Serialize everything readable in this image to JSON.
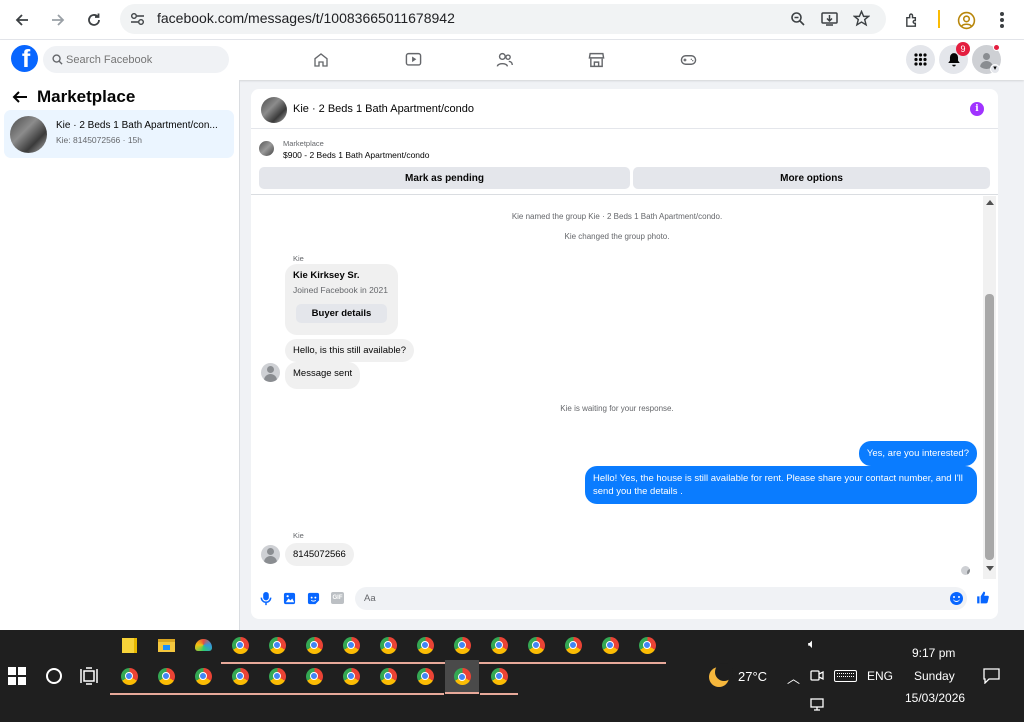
{
  "browser": {
    "url": "facebook.com/messages/t/10083665011678942"
  },
  "fb": {
    "search_placeholder": "Search Facebook",
    "notif_count": "9"
  },
  "sidebar": {
    "title": "Marketplace",
    "conversation": {
      "title": "Kie · 2 Beds 1 Bath Apartment/con...",
      "subtitle": "Kie: 8145072566 · 15h"
    }
  },
  "chat": {
    "title": "Kie · 2 Beds 1 Bath Apartment/condo",
    "listing_label": "Marketplace",
    "listing_detail": "$900 - 2 Beds 1 Bath Apartment/condo",
    "mark_pending": "Mark as pending",
    "more_options": "More options",
    "sys1": "Kie named the group Kie · 2 Beds 1 Bath Apartment/condo.",
    "sys2": "Kie changed the group photo.",
    "sender1": "Kie",
    "buyer_name": "Kie Kirksey Sr.",
    "buyer_joined": "Joined Facebook in 2021",
    "buyer_details_btn": "Buyer details",
    "msg1": "Hello, is this still available?",
    "msg2": "Message sent",
    "sys3": "Kie is waiting for your response.",
    "out1": "Yes, are you interested?",
    "out2": "Hello! Yes, the house is still available for rent. Please share your contact number, and I'll send you the details .",
    "sender2": "Kie",
    "msg3": "8145072566",
    "composer_placeholder": "Aa"
  },
  "taskbar": {
    "weather": "27°C",
    "lang": "ENG",
    "time": "9:17 pm",
    "day": "Sunday",
    "date": "15/03/2026"
  },
  "colors": {
    "fb_blue": "#0866ff",
    "messenger_blue": "#0a7cff",
    "purple_info": "#a033ff",
    "notif_red": "#e41e3f"
  }
}
